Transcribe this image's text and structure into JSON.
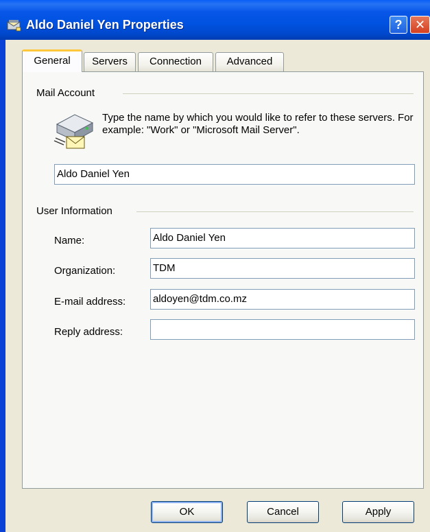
{
  "window": {
    "title": "Aldo Daniel Yen Properties",
    "help_glyph": "?",
    "close_glyph": "✕"
  },
  "tabs": [
    {
      "label": "General",
      "active": true
    },
    {
      "label": "Servers",
      "active": false
    },
    {
      "label": "Connection",
      "active": false
    },
    {
      "label": "Advanced",
      "active": false
    }
  ],
  "mail_account": {
    "heading": "Mail Account",
    "description": "Type the name by which you would like to refer to these servers.  For example: \"Work\" or \"Microsoft Mail Server\".",
    "account_name_value": "Aldo Daniel Yen",
    "icon": "mail-server-icon"
  },
  "user_information": {
    "heading": "User Information",
    "fields": [
      {
        "label": "Name:",
        "value": "Aldo Daniel Yen"
      },
      {
        "label": "Organization:",
        "value": "TDM"
      },
      {
        "label": "E-mail address:",
        "value": "aldoyen@tdm.co.mz"
      },
      {
        "label": "Reply address:",
        "value": ""
      }
    ]
  },
  "buttons": {
    "ok": "OK",
    "cancel": "Cancel",
    "apply": "Apply"
  },
  "colors": {
    "titlebar": "#0054e3",
    "dialog_bg": "#ece9d8",
    "tab_accent": "#ffc83c",
    "input_border": "#7f9db9"
  }
}
